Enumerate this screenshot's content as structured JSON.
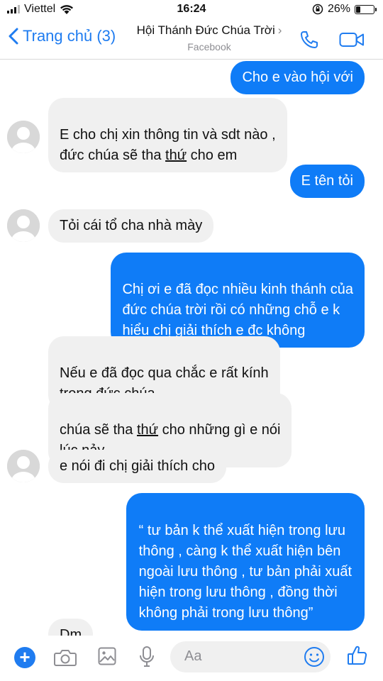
{
  "status_bar": {
    "carrier": "Viettel",
    "time": "16:24",
    "battery": "26%",
    "battery_level": 0.26
  },
  "header": {
    "back_label": "Trang chủ (3)",
    "title": "Hội Thánh Đức Chúa Trời",
    "subtitle": "Facebook"
  },
  "messages": [
    {
      "side": "out",
      "text": "Cho e vào hội với"
    },
    {
      "side": "in",
      "parts": [
        "E cho chị xin thông tin và sdt nào ,\nđức chúa sẽ tha ",
        "thứ",
        " cho em"
      ]
    },
    {
      "side": "out",
      "text": "E tên tỏi"
    },
    {
      "side": "in",
      "text": "Tỏi cái tổ cha nhà mày"
    },
    {
      "side": "out",
      "text": "Chị ơi e đã đọc nhiều kinh thánh của\nđức chúa trời rồi có những chỗ e k\nhiểu chị giải thích e đc không"
    },
    {
      "side": "in",
      "text": "Nếu e đã đọc qua chắc e rất kính\ntrọng đức chúa"
    },
    {
      "side": "in",
      "parts": [
        "chúa sẽ tha ",
        "thứ",
        " cho những gì e nói\nlúc nảy"
      ]
    },
    {
      "side": "in",
      "text": "e nói đi chị giải thích cho"
    },
    {
      "side": "out",
      "text": "“ tư bản k thể xuất hiện trong lưu\nthông , càng k thể xuất hiện bên\nngoài lưu thông , tư bản phải xuất\nhiện trong lưu thông , đồng thời\nkhông phải trong lưu thông”"
    },
    {
      "side": "in",
      "text": "Dm"
    }
  ],
  "composer": {
    "placeholder": "Aa"
  },
  "colors": {
    "accent": "#1f7cf0",
    "outgoing_bubble": "#0f7cf7",
    "incoming_bubble": "#f0f0f0"
  }
}
